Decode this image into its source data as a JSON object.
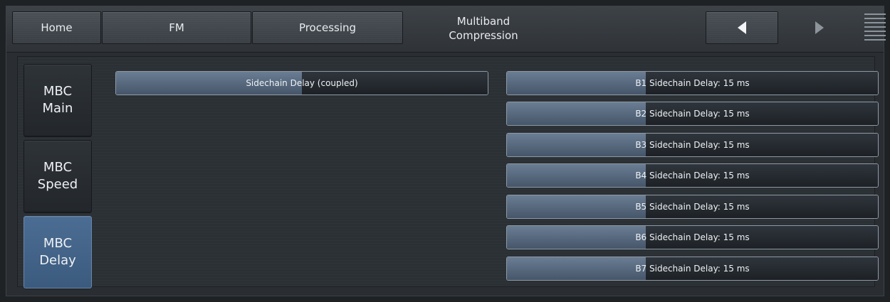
{
  "nav": {
    "home_label": "Home",
    "fm_label": "FM",
    "processing_label": "Processing",
    "title_line1": "Multiband",
    "title_line2": "Compression",
    "back_icon": "triangle-left",
    "forward_icon": "triangle-right",
    "menu_icon": "hamburger-lines"
  },
  "sidebar": {
    "items": [
      {
        "line1": "MBC",
        "line2": "Main",
        "active": false
      },
      {
        "line1": "MBC",
        "line2": "Speed",
        "active": false
      },
      {
        "line1": "MBC",
        "line2": "Delay",
        "active": true
      }
    ]
  },
  "controls": {
    "coupled": {
      "label": "Sidechain Delay (coupled)",
      "level": 0.5
    },
    "bands": [
      {
        "label": "B1 Sidechain Delay: 15 ms",
        "level": 0.375
      },
      {
        "label": "B2 Sidechain Delay: 15 ms",
        "level": 0.375
      },
      {
        "label": "B3 Sidechain Delay: 15 ms",
        "level": 0.375
      },
      {
        "label": "B4 Sidechain Delay: 15 ms",
        "level": 0.375
      },
      {
        "label": "B5 Sidechain Delay: 15 ms",
        "level": 0.375
      },
      {
        "label": "B6 Sidechain Delay: 15 ms",
        "level": 0.375
      },
      {
        "label": "B7 Sidechain Delay: 15 ms",
        "level": 0.375
      }
    ]
  },
  "colors": {
    "active_tab": "#4c6d93",
    "slider_fill": "#5a6c82",
    "background": "#2b3035"
  }
}
